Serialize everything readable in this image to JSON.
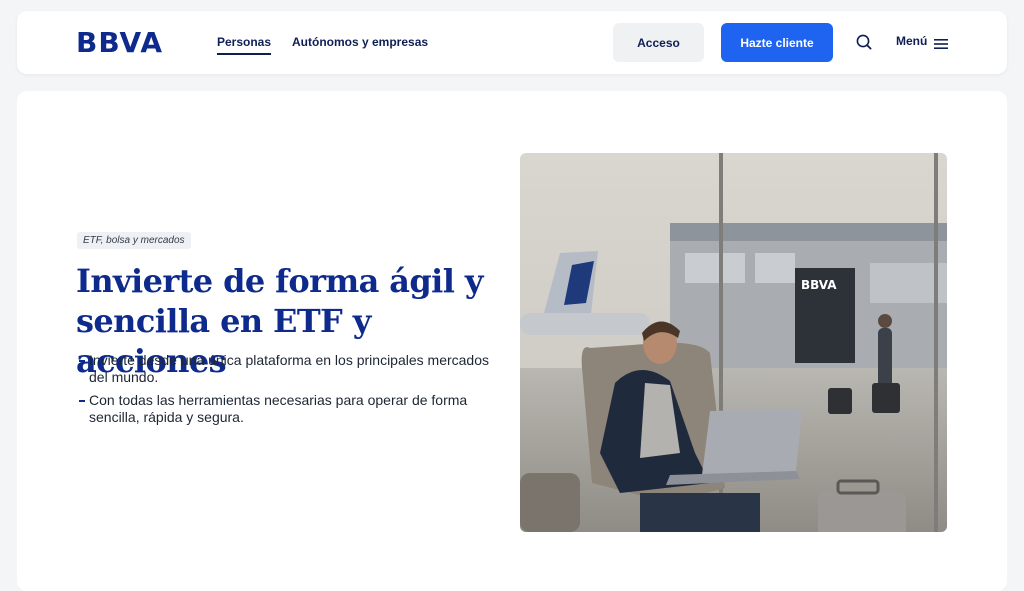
{
  "header": {
    "logo": "BBVA",
    "nav": [
      {
        "label": "Personas",
        "active": true
      },
      {
        "label": "Autónomos y empresas",
        "active": false
      }
    ],
    "acceso_label": "Acceso",
    "cliente_label": "Hazte cliente",
    "menu_label": "Menú",
    "search_icon": "search-icon",
    "menu_icon": "hamburger-icon"
  },
  "hero": {
    "tag": "ETF, bolsa y mercados",
    "title": "Invierte de forma ágil y sencilla en ETF y acciones",
    "bullets": [
      "Invierte desde una única plataforma en los principales mercados del mundo.",
      "Con todas las herramientas necesarias para operar de forma sencilla, rápida y segura."
    ],
    "image_sign_text": "BBVA"
  },
  "colors": {
    "brand_navy": "#0e2a8c",
    "primary_blue": "#1e64f0",
    "page_bg": "#f4f5f6"
  }
}
